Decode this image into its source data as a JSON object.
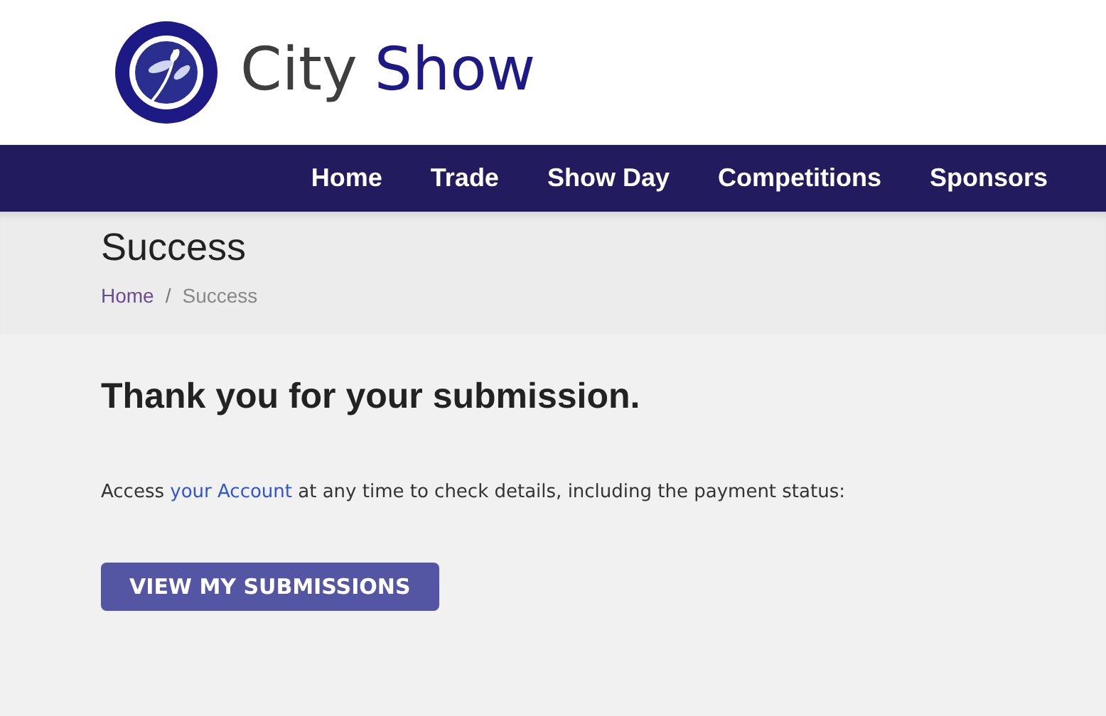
{
  "logo": {
    "words": [
      "City",
      "Show"
    ]
  },
  "nav": [
    {
      "label": "Home"
    },
    {
      "label": "Trade"
    },
    {
      "label": "Show Day"
    },
    {
      "label": "Competitions"
    },
    {
      "label": "Sponsors"
    }
  ],
  "page_title": "Success",
  "breadcrumb": [
    {
      "label": "Home",
      "kind": "link"
    },
    {
      "label": "Success",
      "kind": "current"
    }
  ],
  "breadcrumb_separator": "/",
  "heading": "Thank you for your submission.",
  "message": {
    "before": "Access ",
    "link": "your Account",
    "after": " at any time to check details, including the payment status:"
  },
  "button": "VIEW MY SUBMISSIONS"
}
